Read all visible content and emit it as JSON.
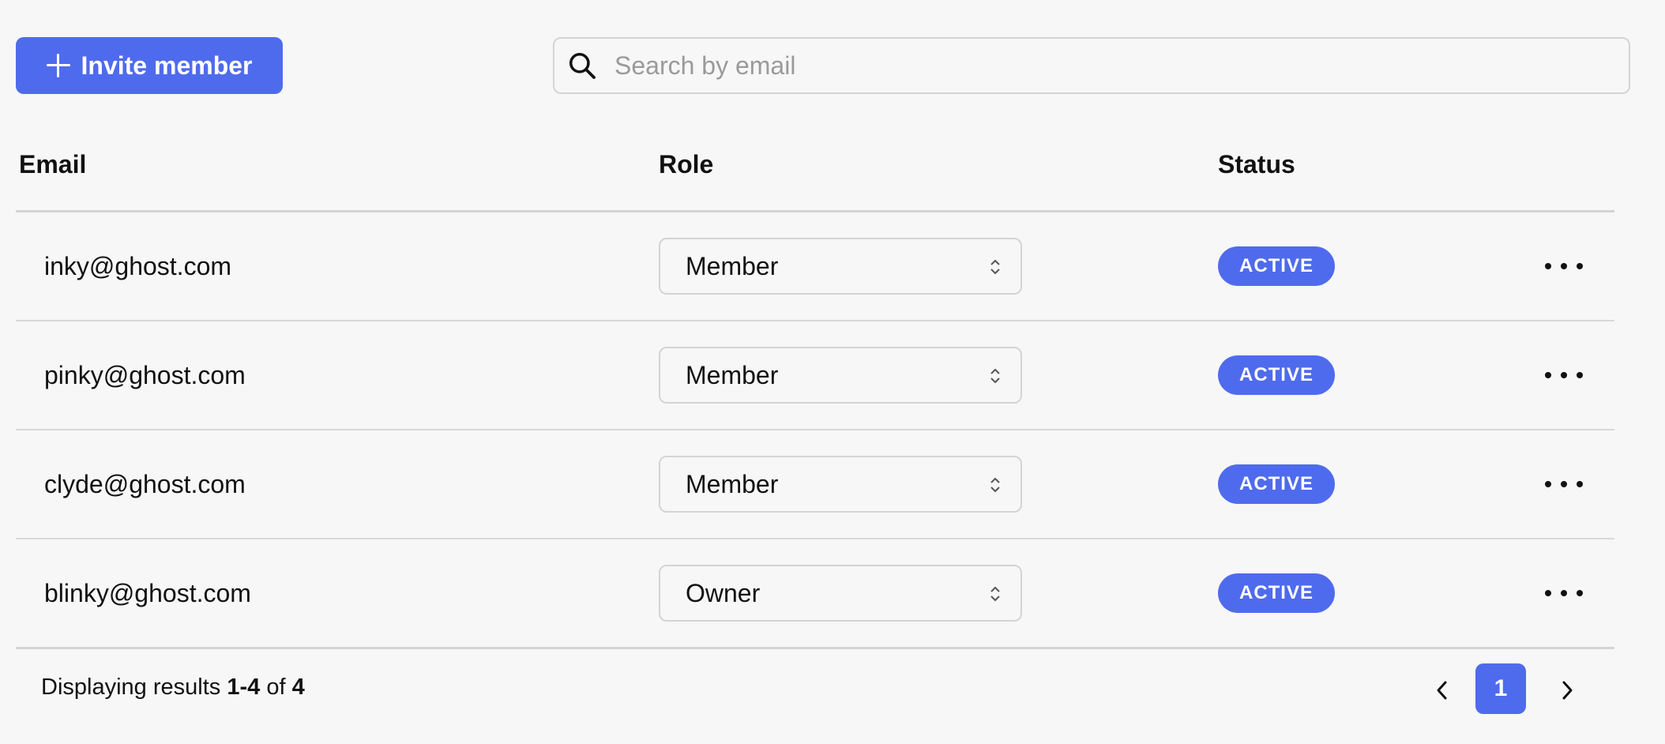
{
  "toolbar": {
    "invite_label": "Invite member",
    "search_placeholder": "Search by email",
    "search_value": ""
  },
  "table": {
    "headers": {
      "email": "Email",
      "role": "Role",
      "status": "Status"
    },
    "rows": [
      {
        "email": "inky@ghost.com",
        "role": "Member",
        "status": "ACTIVE"
      },
      {
        "email": "pinky@ghost.com",
        "role": "Member",
        "status": "ACTIVE"
      },
      {
        "email": "clyde@ghost.com",
        "role": "Member",
        "status": "ACTIVE"
      },
      {
        "email": "blinky@ghost.com",
        "role": "Owner",
        "status": "ACTIVE"
      }
    ]
  },
  "footer": {
    "prefix": "Displaying results",
    "range": "1-4",
    "of": "of",
    "total": "4",
    "current_page": "1"
  },
  "colors": {
    "accent": "#4f6bed",
    "background": "#f7f7f7",
    "border": "#d4d4d4"
  },
  "icons": {
    "invite": "plus-icon",
    "search": "search-icon",
    "role_select": "chevron-up-down-icon",
    "row_actions": "more-horizontal-icon",
    "prev": "chevron-left-icon",
    "next": "chevron-right-icon"
  }
}
